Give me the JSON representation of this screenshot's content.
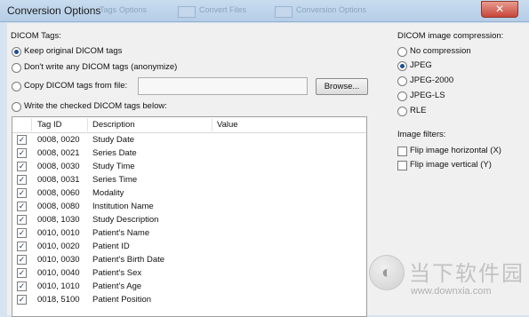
{
  "window": {
    "title": "Conversion Options",
    "close_glyph": "✕",
    "ghost_text_1": "Tags",
    "ghost_text_2": "Options",
    "ghost_text_3": "Convert Files",
    "ghost_text_4": "Conversion Options"
  },
  "dicom_tags": {
    "group_label": "DICOM Tags:",
    "options": [
      {
        "label": "Keep original DICOM tags",
        "checked": true
      },
      {
        "label": "Don't write any DICOM tags (anonymize)",
        "checked": false
      },
      {
        "label": "Copy DICOM tags from file:",
        "checked": false
      },
      {
        "label": "Write the checked DICOM tags below:",
        "checked": false
      }
    ],
    "copy_file_value": "",
    "browse_label": "Browse..."
  },
  "table": {
    "headers": [
      "Tag ID",
      "Description",
      "Value"
    ],
    "rows": [
      {
        "tag": "0008, 0020",
        "desc": "Study Date",
        "value": "",
        "checked": true
      },
      {
        "tag": "0008, 0021",
        "desc": "Series Date",
        "value": "",
        "checked": true
      },
      {
        "tag": "0008, 0030",
        "desc": "Study Time",
        "value": "",
        "checked": true
      },
      {
        "tag": "0008, 0031",
        "desc": "Series Time",
        "value": "",
        "checked": true
      },
      {
        "tag": "0008, 0060",
        "desc": "Modality",
        "value": "",
        "checked": true
      },
      {
        "tag": "0008, 0080",
        "desc": "Institution Name",
        "value": "",
        "checked": true
      },
      {
        "tag": "0008, 1030",
        "desc": "Study Description",
        "value": "",
        "checked": true
      },
      {
        "tag": "0010, 0010",
        "desc": "Patient's Name",
        "value": "",
        "checked": true
      },
      {
        "tag": "0010, 0020",
        "desc": "Patient ID",
        "value": "",
        "checked": true
      },
      {
        "tag": "0010, 0030",
        "desc": "Patient's Birth Date",
        "value": "",
        "checked": true
      },
      {
        "tag": "0010, 0040",
        "desc": "Patient's Sex",
        "value": "",
        "checked": true
      },
      {
        "tag": "0010, 1010",
        "desc": "Patient's Age",
        "value": "",
        "checked": true
      },
      {
        "tag": "0018, 5100",
        "desc": "Patient Position",
        "value": "",
        "checked": true
      }
    ]
  },
  "compression": {
    "group_label": "DICOM image compression:",
    "options": [
      {
        "label": "No compression",
        "checked": false
      },
      {
        "label": "JPEG",
        "checked": true
      },
      {
        "label": "JPEG-2000",
        "checked": false
      },
      {
        "label": "JPEG-LS",
        "checked": false
      },
      {
        "label": "RLE",
        "checked": false
      }
    ]
  },
  "filters": {
    "group_label": "Image filters:",
    "options": [
      {
        "label": "Flip image horizontal (X)",
        "checked": false
      },
      {
        "label": "Flip image vertical (Y)",
        "checked": false
      }
    ]
  },
  "watermark": {
    "logo_glyph": "◐",
    "cn_text": "当下软件园",
    "url": "www.downxia.com"
  },
  "check_glyph": "✓"
}
